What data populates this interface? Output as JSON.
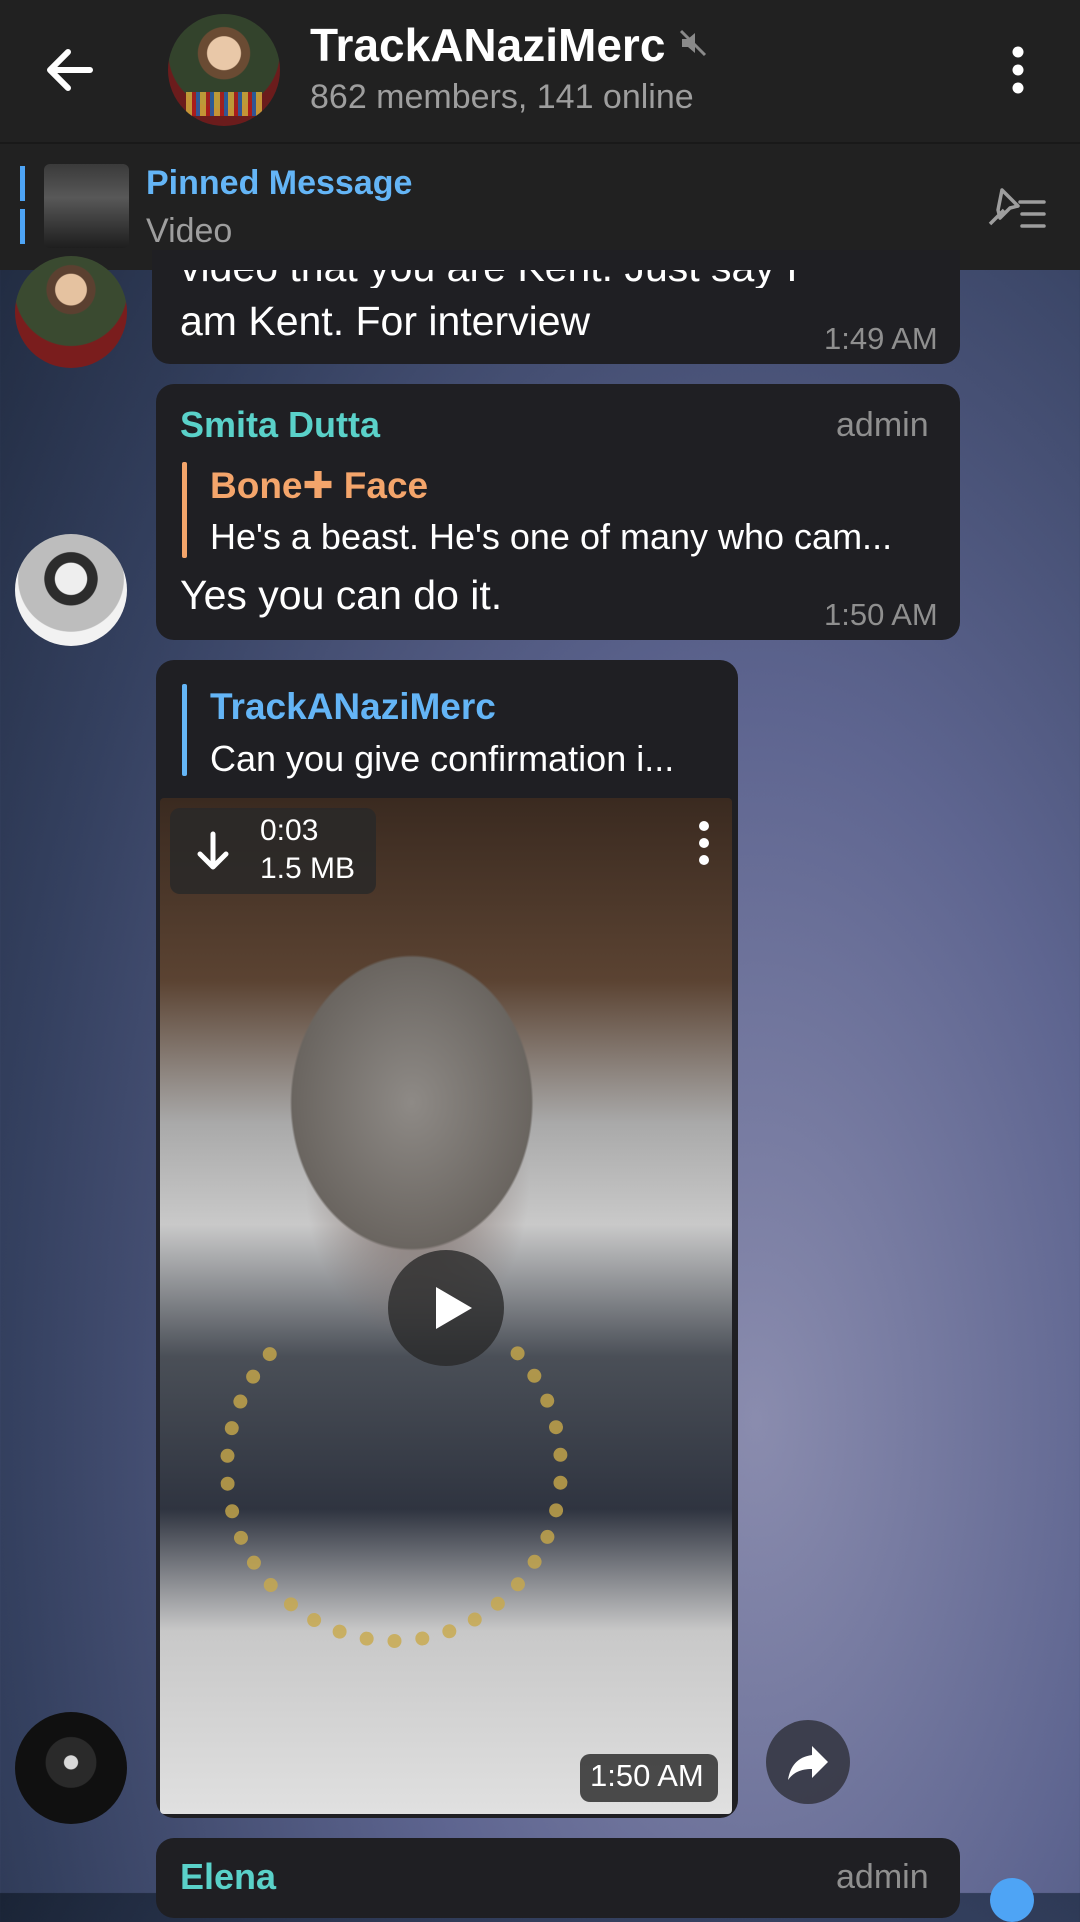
{
  "header": {
    "channel_title": "TrackANaziMerc",
    "subtitle": "862 members, 141 online"
  },
  "pinned": {
    "label": "Pinned Message",
    "preview": "Video"
  },
  "messages": [
    {
      "text_line1": "video that you are Kent. Just say I",
      "text_line2": "am Kent. For interview",
      "time": "1:49 AM"
    },
    {
      "sender": "Smita Dutta",
      "role": "admin",
      "reply_name": "Bone✚ Face",
      "reply_text": "He's a beast. He's one of many who cam...",
      "text": "Yes you can do it.",
      "time": "1:50 AM"
    },
    {
      "reply_name": "TrackANaziMerc",
      "reply_text": "Can you give confirmation i...",
      "video_duration": "0:03",
      "video_size": "1.5 MB",
      "time": "1:50 AM"
    },
    {
      "sender": "Elena",
      "role": "admin"
    }
  ],
  "colors": {
    "accent": "#64b5f6",
    "sender_teal": "#5ad1c9",
    "reply_orange": "#f4a56b"
  }
}
